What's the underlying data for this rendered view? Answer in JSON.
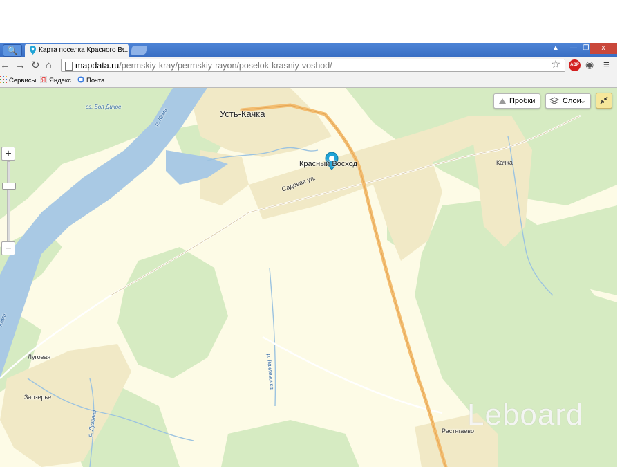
{
  "browser": {
    "tab_title": "Карта поселка Красного В...",
    "tab_close": "×",
    "window_buttons": {
      "user": "▲",
      "minimize": "—",
      "maximize": "❐",
      "close": "x"
    },
    "url_host": "mapdata.ru",
    "url_path": "/permskiy-kray/permskiy-rayon/poselok-krasniy-voshod/",
    "extension_badge": "ABP",
    "nav_icons": [
      "back-icon",
      "forward-icon",
      "reload-icon",
      "home-icon"
    ]
  },
  "bookmarks": [
    {
      "label": "Сервисы",
      "icon": "apps-grid-icon"
    },
    {
      "label": "Яндекс",
      "icon": "yandex-icon"
    },
    {
      "label": "Почта",
      "icon": "mail-icon"
    }
  ],
  "map": {
    "controls": {
      "traffic_label": "Пробки",
      "layers_label": "Слои",
      "zoom_in": "+",
      "zoom_out": "−"
    },
    "places": [
      {
        "key": "ust_kachka",
        "label": "Усть-Качка"
      },
      {
        "key": "krasny_voshod",
        "label": "Красный Восход"
      },
      {
        "key": "kachka",
        "label": "Качка"
      },
      {
        "key": "lugovaya",
        "label": "Луговая"
      },
      {
        "key": "zaozerye",
        "label": "Заозерье"
      },
      {
        "key": "rastyagaevo",
        "label": "Растягаево"
      }
    ],
    "streets": {
      "sadovaya": "Садовая ул."
    },
    "water_labels": {
      "lake": "оз. Бол Дикое",
      "kama": "р. Кама",
      "kakhlevochka": "р. Кахлевочка",
      "lugovaya_river": "р. Луговая",
      "kama_left": "Кама"
    },
    "colors": {
      "land": "#fdfbe6",
      "forest": "#d6ebc2",
      "water": "#a9c9e4",
      "settlement": "#f1e9c6",
      "highway": "#f3bd70",
      "marker": "#1fa3d6"
    },
    "watermark": "Leboard"
  }
}
